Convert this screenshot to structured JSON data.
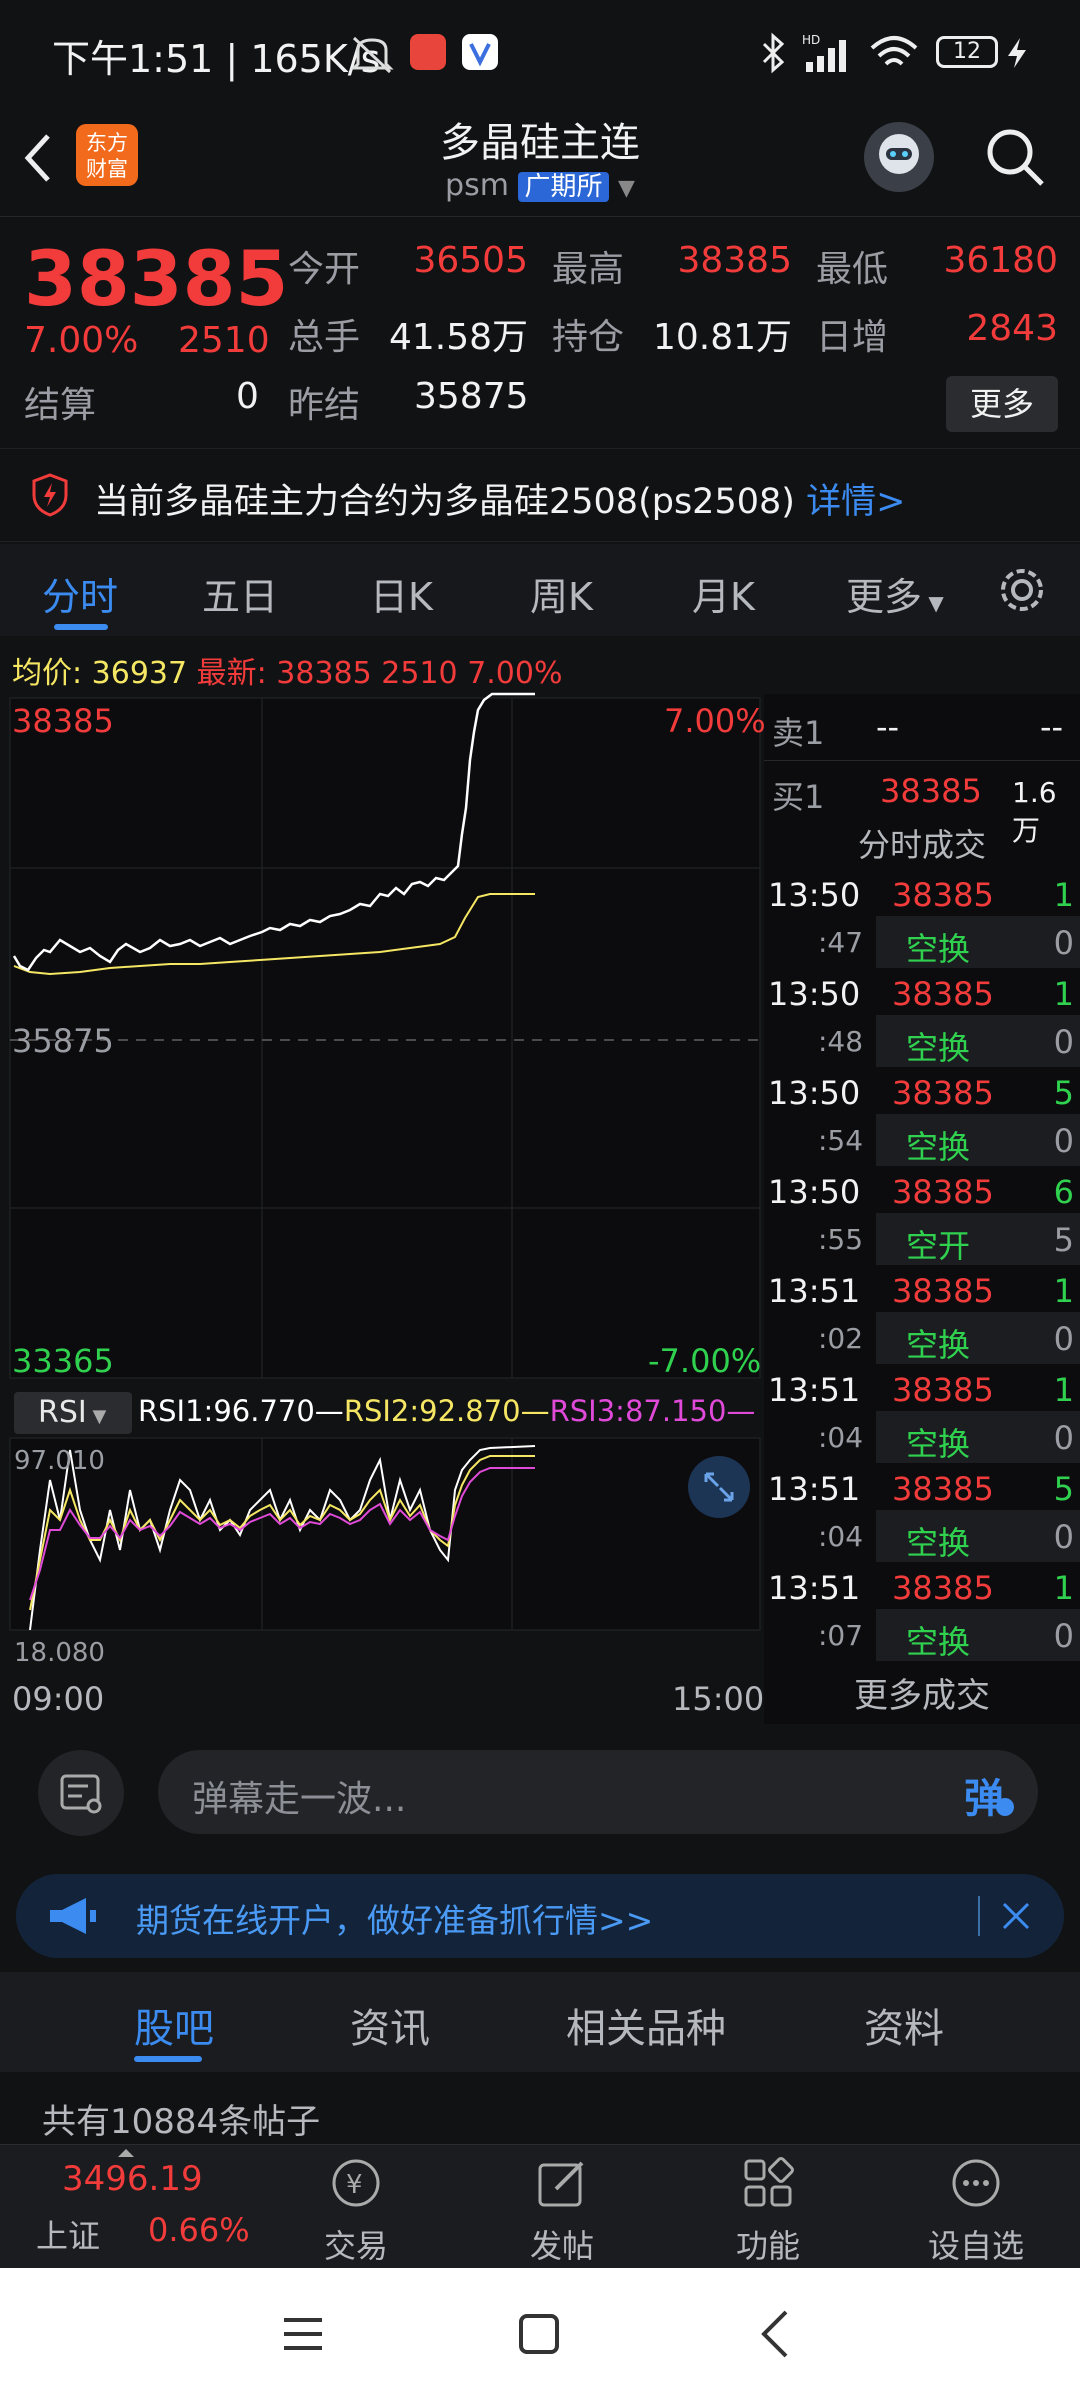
{
  "status_bar": {
    "time": "下午1:51",
    "net_speed": "165K/s",
    "battery": "12"
  },
  "header": {
    "title": "多晶硅主连",
    "code": "psm",
    "exchange": "广期所",
    "logo_text": "东方财富"
  },
  "quote": {
    "price": "38385",
    "change_pct": "7.00%",
    "change": "2510",
    "open_label": "今开",
    "open": "36505",
    "high_label": "最高",
    "high": "38385",
    "low_label": "最低",
    "low": "36180",
    "volume_label": "总手",
    "volume": "41.58万",
    "oi_label": "持仓",
    "oi": "10.81万",
    "daily_inc_label": "日增",
    "daily_inc": "2843",
    "settle_label": "结算",
    "settle": "0",
    "prev_settle_label": "昨结",
    "prev_settle": "35875",
    "more_label": "更多"
  },
  "notice": {
    "text": "当前多晶硅主力合约为多晶硅2508(ps2508)",
    "link": "详情>"
  },
  "tabs": [
    "分时",
    "五日",
    "日K",
    "周K",
    "月K",
    "更多"
  ],
  "chart": {
    "avg_label": "均价:",
    "avg": "36937",
    "latest_label": "最新:",
    "latest": "38385",
    "latest_change": "2510",
    "latest_pct": "7.00%",
    "y_top": "38385",
    "y_mid": "35875",
    "y_bottom": "33365",
    "pct_top": "7.00%",
    "pct_bottom": "-7.00%",
    "rsi_selector": "RSI",
    "rsi1": "RSI1:96.770—",
    "rsi2": "RSI2:92.870—",
    "rsi3": "RSI3:87.150—",
    "rsi_top": "97.010",
    "rsi_bottom": "18.080",
    "time_start": "09:00",
    "time_end": "15:00",
    "colors": {
      "price": "#ffffff",
      "avg": "#f5e663",
      "rsi1": "#ffffff",
      "rsi2": "#f5e663",
      "rsi3": "#e04ad8"
    }
  },
  "orderbook": {
    "ask_label": "卖1",
    "ask_price": "--",
    "ask_vol": "--",
    "bid_label": "买1",
    "bid_price": "38385",
    "bid_vol": "1.6万",
    "trades_title": "分时成交",
    "more_trades": "更多成交",
    "trades": [
      {
        "t1": "13:50",
        "p": "38385",
        "v1": "1",
        "t2": ":47",
        "type": "空换",
        "v2": "0"
      },
      {
        "t1": "13:50",
        "p": "38385",
        "v1": "1",
        "t2": ":48",
        "type": "空换",
        "v2": "0"
      },
      {
        "t1": "13:50",
        "p": "38385",
        "v1": "5",
        "t2": ":54",
        "type": "空换",
        "v2": "0"
      },
      {
        "t1": "13:50",
        "p": "38385",
        "v1": "6",
        "t2": ":55",
        "type": "空开",
        "v2": "5"
      },
      {
        "t1": "13:51",
        "p": "38385",
        "v1": "1",
        "t2": ":02",
        "type": "空换",
        "v2": "0"
      },
      {
        "t1": "13:51",
        "p": "38385",
        "v1": "1",
        "t2": ":04",
        "type": "空换",
        "v2": "0"
      },
      {
        "t1": "13:51",
        "p": "38385",
        "v1": "5",
        "t2": ":04",
        "type": "空换",
        "v2": "0"
      },
      {
        "t1": "13:51",
        "p": "38385",
        "v1": "1",
        "t2": ":07",
        "type": "空换",
        "v2": "0"
      }
    ]
  },
  "comment": {
    "placeholder": "弹幕走一波...",
    "danmu_label": "弹"
  },
  "ad": {
    "text": "期货在线开户，做好准备抓行情>>"
  },
  "bottom_tabs": [
    "股吧",
    "资讯",
    "相关品种",
    "资料"
  ],
  "post_count": "共有10884条帖子",
  "bottom_nav": {
    "index_value": "3496.19",
    "index_name": "上证",
    "index_pct": "0.66%",
    "items": [
      "交易",
      "发帖",
      "功能",
      "设自选"
    ]
  }
}
